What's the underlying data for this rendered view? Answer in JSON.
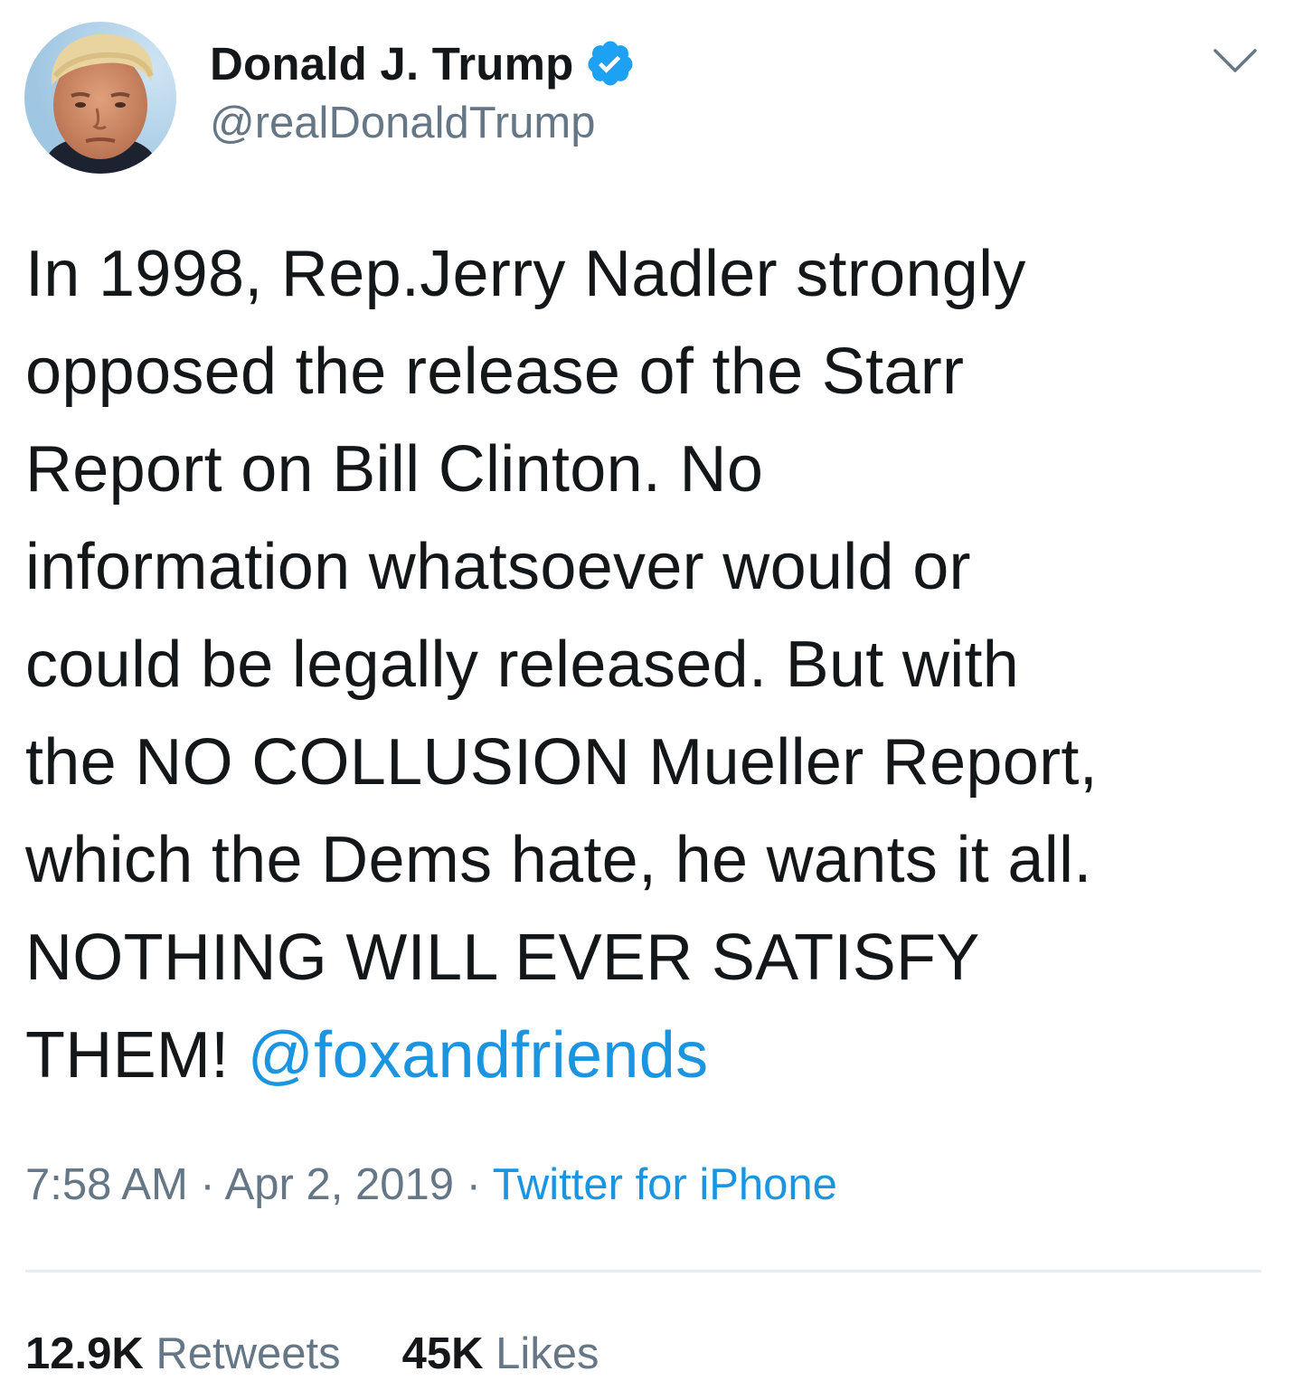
{
  "header": {
    "display_name": "Donald J. Trump",
    "handle": "@realDonaldTrump",
    "avatar_icon": "profile-photo",
    "verified_icon": "verified-badge-icon",
    "menu_icon": "chevron-down-icon"
  },
  "tweet": {
    "text_lines": [
      "In 1998, Rep.Jerry Nadler strongly",
      "opposed the release of the Starr",
      "Report on Bill Clinton. No",
      "information whatsoever would or",
      "could be legally released. But with",
      "the NO COLLUSION Mueller Report,",
      "which the Dems hate, he wants it all.",
      "NOTHING WILL EVER SATISFY",
      "THEM!"
    ],
    "mention": "@foxandfriends"
  },
  "meta": {
    "time": "7:58 AM",
    "sep1": " · ",
    "date": "Apr 2, 2019",
    "sep2": " · ",
    "source": "Twitter for iPhone"
  },
  "stats": {
    "retweets_count": "12.9K",
    "retweets_label": "Retweets",
    "likes_count": "45K",
    "likes_label": "Likes"
  },
  "colors": {
    "link": "#1b95e0",
    "verified": "#1da1f2",
    "muted": "#657786",
    "text": "#14171a",
    "divider": "#e6ecf0"
  }
}
